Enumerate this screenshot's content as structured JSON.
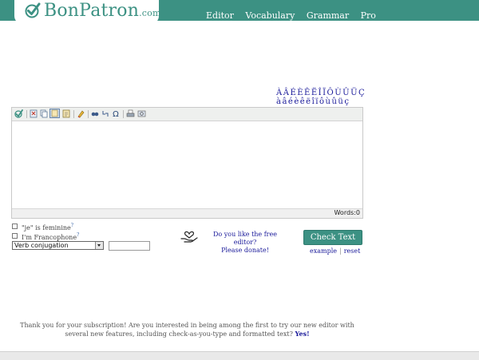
{
  "header": {
    "brand": "BonPatron",
    "brand_suffix": ".com",
    "nav": [
      {
        "label": "Editor"
      },
      {
        "label": "Vocabulary"
      },
      {
        "label": "Grammar"
      },
      {
        "label": "Pro"
      }
    ]
  },
  "special_chars": {
    "upper": "ÀÂÉÈÊËÎÏÔÙÛÜÇ",
    "lower": "àâéèêëîïôùûüç"
  },
  "editor": {
    "toolbar_icons": [
      "check-logo-icon",
      "cut-icon",
      "copy-icon",
      "paste-icon",
      "paste-text-icon",
      "eraser-icon",
      "find-icon",
      "replace-icon",
      "omega-icon",
      "print-icon",
      "preview-icon"
    ],
    "words_label": "Words:0"
  },
  "options": {
    "feminine_label": "\"je\" is feminine",
    "francophone_label": "I'm Francophone",
    "help_mark": "?",
    "select_value": "Verb conjugation"
  },
  "donate": {
    "line1": "Do you like the free editor?",
    "line2": "Please donate!"
  },
  "check": {
    "button_label": "Check Text",
    "example_label": "example",
    "separator": "|",
    "reset_label": "reset"
  },
  "message": {
    "text": "Thank you for your subscription! Are you interested in being among the first to try our new editor with several new features, including check-as-you-type and formatted text?",
    "yes_label": "Yes!"
  },
  "colors": {
    "brand": "#3c9183",
    "link": "#1a1a9a"
  }
}
